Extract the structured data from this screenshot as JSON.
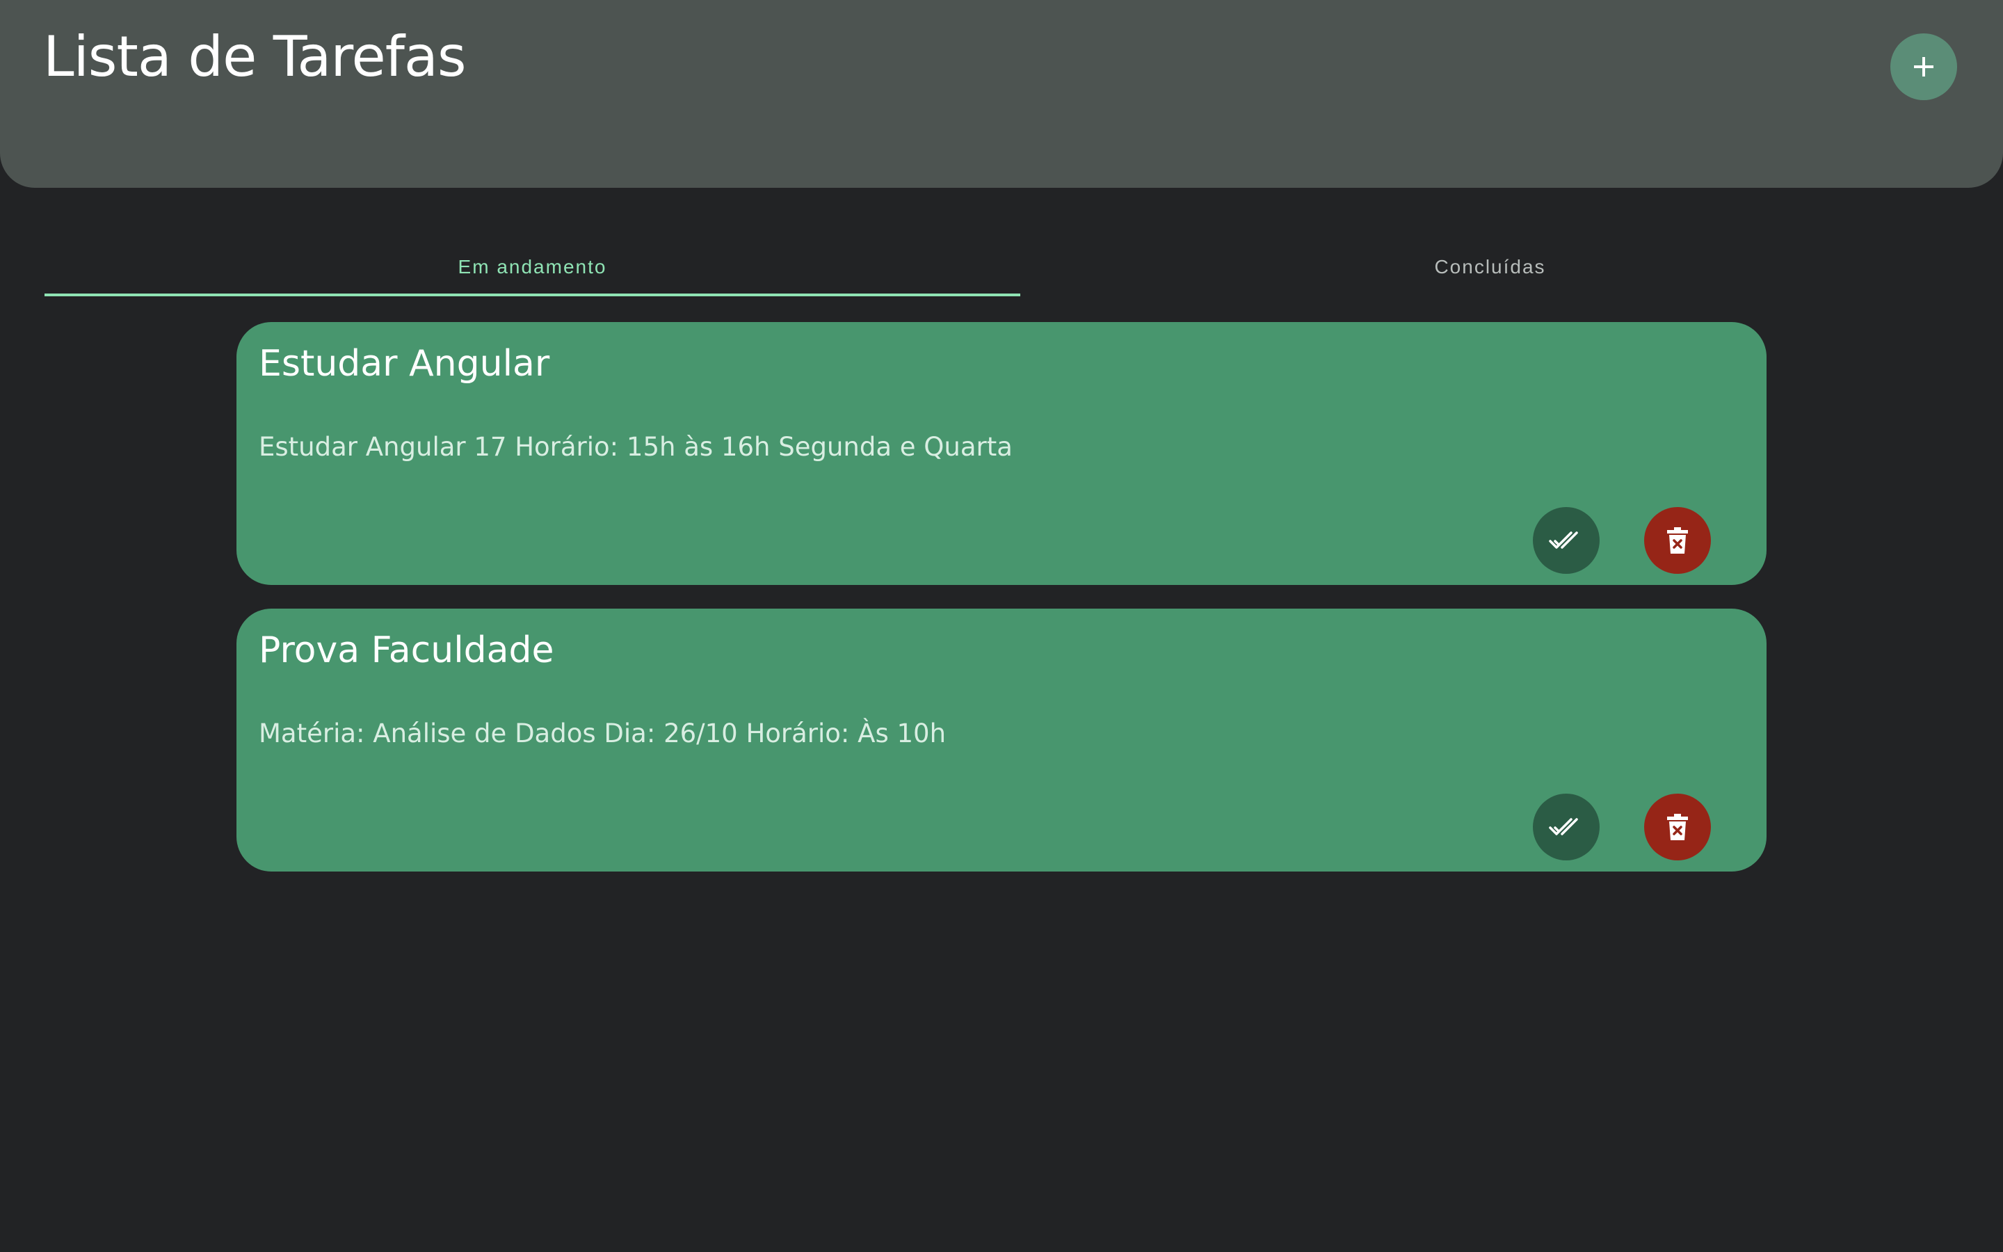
{
  "header": {
    "title": "Lista de Tarefas",
    "add_icon": "plus-icon"
  },
  "tabs": [
    {
      "label": "Em andamento",
      "active": true
    },
    {
      "label": "Concluídas",
      "active": false
    }
  ],
  "tasks": [
    {
      "title": "Estudar Angular",
      "description": "Estudar Angular 17 Horário: 15h às 16h Segunda e Quarta",
      "done_icon": "double-check-icon",
      "delete_icon": "trash-icon"
    },
    {
      "title": "Prova Faculdade",
      "description": "Matéria: Análise de Dados Dia: 26/10 Horário: Às 10h",
      "done_icon": "double-check-icon",
      "delete_icon": "trash-icon"
    }
  ],
  "colors": {
    "background": "#222325",
    "header": "#4d5451",
    "accent": "#8fe3b4",
    "card": "#48966e",
    "done_button": "#2b5c45",
    "delete_button": "#962517"
  }
}
